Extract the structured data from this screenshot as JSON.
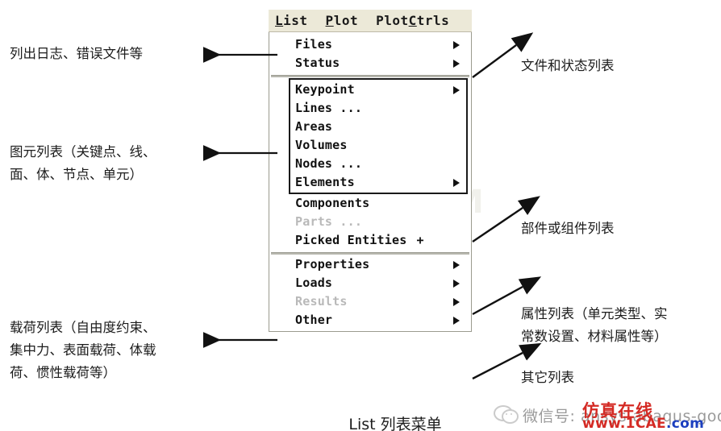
{
  "menubar": {
    "items": [
      {
        "pre": "",
        "mnemonic": "L",
        "post": "ist"
      },
      {
        "pre": "",
        "mnemonic": "P",
        "post": "lot"
      },
      {
        "pre": "Plot",
        "mnemonic": "C",
        "post": "trls"
      }
    ]
  },
  "menu": {
    "groups": [
      {
        "name": "files-status",
        "boxed": false,
        "items": [
          {
            "label": "Files",
            "submenu": true,
            "disabled": false,
            "suffix": ""
          },
          {
            "label": "Status",
            "submenu": true,
            "disabled": false,
            "suffix": ""
          }
        ]
      },
      {
        "name": "entities",
        "boxed": true,
        "items": [
          {
            "label": "Keypoint",
            "submenu": true,
            "disabled": false,
            "suffix": ""
          },
          {
            "label": "Lines ...",
            "submenu": false,
            "disabled": false,
            "suffix": ""
          },
          {
            "label": "Areas",
            "submenu": false,
            "disabled": false,
            "suffix": ""
          },
          {
            "label": "Volumes",
            "submenu": false,
            "disabled": false,
            "suffix": ""
          },
          {
            "label": "Nodes ...",
            "submenu": false,
            "disabled": false,
            "suffix": ""
          },
          {
            "label": "Elements",
            "submenu": true,
            "disabled": false,
            "suffix": ""
          }
        ]
      },
      {
        "name": "components",
        "boxed": false,
        "items": [
          {
            "label": "Components",
            "submenu": false,
            "disabled": false,
            "suffix": ""
          },
          {
            "label": "Parts ...",
            "submenu": false,
            "disabled": true,
            "suffix": ""
          },
          {
            "label": "Picked Entities",
            "submenu": false,
            "disabled": false,
            "suffix": "+"
          }
        ]
      },
      {
        "name": "properties-loads",
        "boxed": false,
        "items": [
          {
            "label": "Properties",
            "submenu": true,
            "disabled": false,
            "suffix": ""
          },
          {
            "label": "Loads",
            "submenu": true,
            "disabled": false,
            "suffix": ""
          },
          {
            "label": "Results",
            "submenu": true,
            "disabled": true,
            "suffix": ""
          },
          {
            "label": "Other",
            "submenu": true,
            "disabled": false,
            "suffix": ""
          }
        ]
      }
    ]
  },
  "annotations": {
    "left": [
      {
        "id": "log-error-files",
        "text": "列出日志、错误文件等"
      },
      {
        "id": "entity-list",
        "text": "图元列表（关键点、线、\n面、体、节点、单元）"
      },
      {
        "id": "load-list",
        "text": "载荷列表（自由度约束、\n集中力、表面载荷、体载\n荷、惯性载荷等）"
      }
    ],
    "right": [
      {
        "id": "file-status-list",
        "text": "文件和状态列表"
      },
      {
        "id": "component-list",
        "text": "部件或组件列表"
      },
      {
        "id": "property-list",
        "text": "属性列表（单元类型、实\n常数设置、材料属性等）"
      },
      {
        "id": "other-list",
        "text": "其它列表"
      }
    ]
  },
  "caption": {
    "text": "List 列表菜单"
  },
  "watermark": {
    "wechat_label": "微信号: ansys-abaqus-god",
    "brand": "仿真在线",
    "url_red": "www.1CAE",
    "url_blue": ".com",
    "ghost": "1CAE.COM"
  },
  "colors": {
    "menubar_bg": "#ece9d8",
    "menu_bg": "#ffffff",
    "text": "#111111",
    "disabled_text": "#b9b9b9",
    "brand_red": "#d42a24",
    "url_blue": "#1c3fbf"
  }
}
